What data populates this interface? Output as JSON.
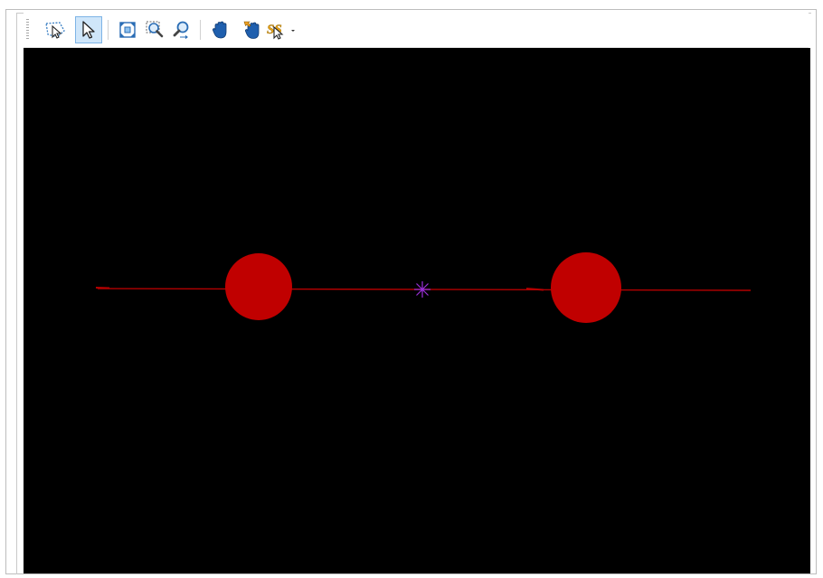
{
  "toolbar": {
    "tools": [
      {
        "name": "select-by-polygon-tool",
        "icon": "polygon-select-arrow-icon",
        "active": false
      },
      {
        "name": "select-tool",
        "icon": "arrow-cursor-icon",
        "active": true
      },
      {
        "name": "zoom-extents-tool",
        "icon": "zoom-extents-icon",
        "active": false
      },
      {
        "name": "zoom-window-tool",
        "icon": "zoom-window-icon",
        "active": false
      },
      {
        "name": "zoom-dynamic-tool",
        "icon": "zoom-magnifier-icon",
        "active": false
      },
      {
        "name": "pan-tool",
        "icon": "hand-icon",
        "active": false
      },
      {
        "name": "pan-continuous-tool",
        "icon": "hand-arrow-icon",
        "active": false
      },
      {
        "name": "snap-tool",
        "icon": "snap-cursor-icon",
        "active": false,
        "has_dropdown": true
      }
    ]
  },
  "canvas": {
    "background": "#000000",
    "line_color": "#b30000",
    "circle_color": "#c00000",
    "center_marker_color": "#9b30d9",
    "objects": [
      "line",
      "circle-left",
      "circle-right",
      "center-marker"
    ]
  }
}
